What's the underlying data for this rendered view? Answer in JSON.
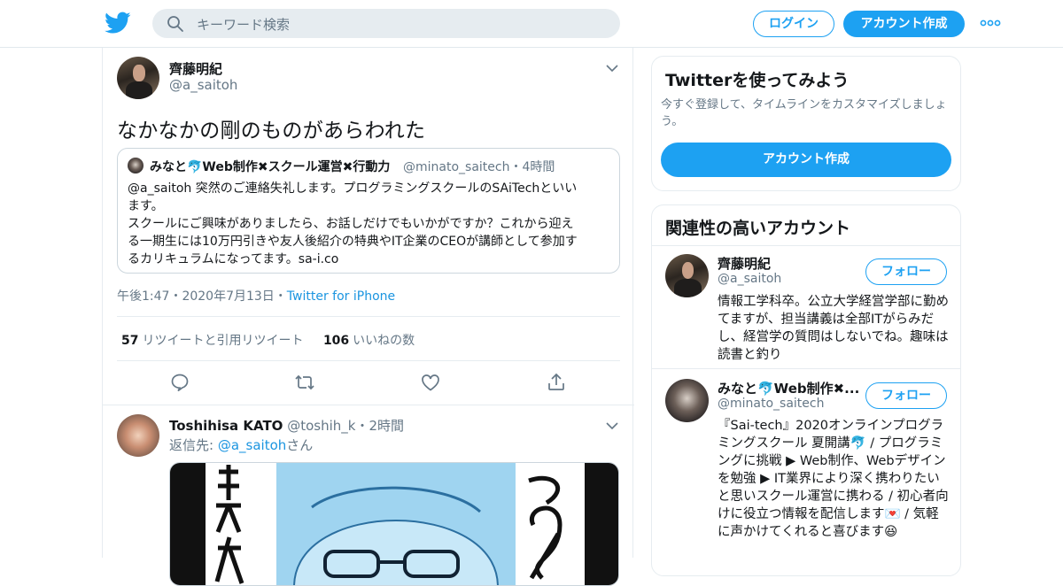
{
  "header": {
    "search_placeholder": "キーワード検索",
    "login_label": "ログイン",
    "signup_label": "アカウント作成",
    "more_icon": "more-icon",
    "logo_icon": "twitter-bird-icon",
    "accent_color": "#1da1f2"
  },
  "tweet": {
    "author_name": "齊藤明紀",
    "author_handle": "@a_saitoh",
    "text": "なかなかの剛のものがあらわれた",
    "quote": {
      "name": "みなと🐬Web制作✖スクール運営✖行動力",
      "handle": "@minato_saitech・4時間",
      "lines": [
        "@a_saitoh 突然のご連絡失礼します。プログラミングスクールのSAiTechといい",
        "ます。",
        "スクールにご興味がありましたら、お話しだけでもいかがですか？これから迎え",
        "る一期生には10万円引きや友人後紹介の特典やIT企業のCEOが講師として参加す",
        "るカリキュラムになってます。sa-i.co"
      ]
    },
    "timestamp": "午後1:47・2020年7月13日・",
    "source": "Twitter for iPhone",
    "retweets_count": "57",
    "retweets_label": "リツイートと引用リツイート",
    "likes_count": "106",
    "likes_label": "いいねの数"
  },
  "reply": {
    "author_name": "Toshihisa KATO",
    "author_handle": "@toshih_k・2時間",
    "reply_to_prefix": "返信先: ",
    "reply_to_handle": "@a_saitoh",
    "reply_to_suffix": "さん"
  },
  "sidebar": {
    "try_title": "Twitterを使ってみよう",
    "try_sub": "今すぐ登録して、タイムラインをカスタマイズしましょう。",
    "try_button": "アカウント作成",
    "related_title": "関連性の高いアカウント",
    "accounts": [
      {
        "name": "齊藤明紀",
        "handle": "@a_saitoh",
        "follow_label": "フォロー",
        "bio": "情報工学科卒。公立大学経営学部に勤めてますが、担当講義は全部ITがらみだし、経営学の質問はしないでね。趣味は読書と釣り"
      },
      {
        "name": "みなと🐬Web制作✖...",
        "handle": "@minato_saitech",
        "follow_label": "フォロー",
        "bio": "『Sai-tech』2020オンラインプログラミングスクール 夏開講🐬 / プログラミングに挑戦 ▶ Web制作、Webデザインを勉強 ▶ IT業界により深く携わりたいと思いスクール運営に携わる / 初心者向けに役立つ情報を配信します💌 / 気軽に声かけてくれると喜びます😆"
      }
    ]
  }
}
